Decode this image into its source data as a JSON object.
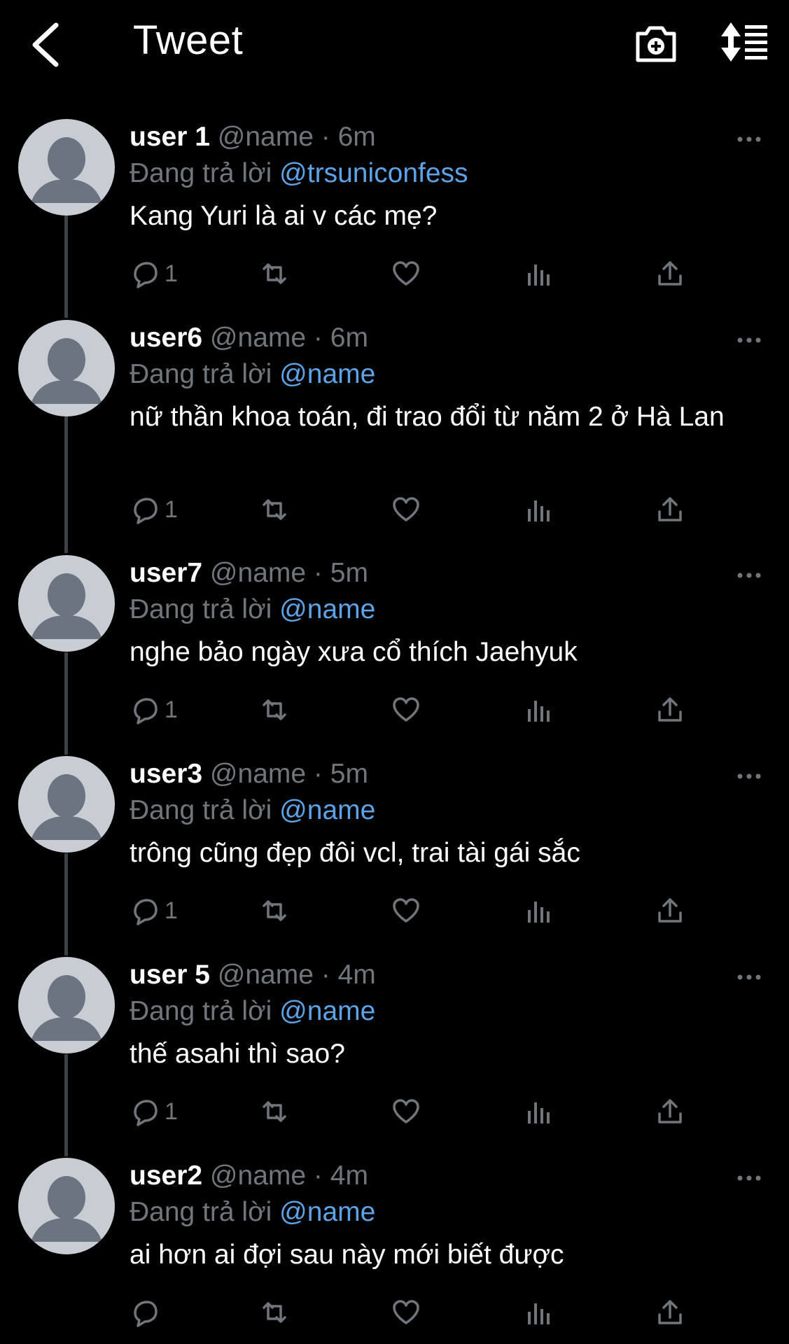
{
  "header": {
    "title": "Tweet"
  },
  "reply_prefix": "Đang trả lời",
  "tweets": [
    {
      "user": "user 1",
      "handle": "@name",
      "time": "6m",
      "mention": "@trsuniconfess",
      "text": "Kang Yuri là ai v các mẹ?",
      "reply_count": "1"
    },
    {
      "user": "user6",
      "handle": "@name",
      "time": "6m",
      "mention": "@name",
      "text": "nữ thần khoa toán, đi trao đổi từ năm 2 ở Hà Lan",
      "reply_count": "1"
    },
    {
      "user": "user7",
      "handle": "@name",
      "time": "5m",
      "mention": "@name",
      "text": "nghe bảo ngày xưa cổ thích Jaehyuk",
      "reply_count": "1"
    },
    {
      "user": "user3",
      "handle": "@name",
      "time": "5m",
      "mention": "@name",
      "text": "trông cũng đẹp đôi vcl, trai tài gái sắc",
      "reply_count": "1"
    },
    {
      "user": "user 5",
      "handle": "@name",
      "time": "4m",
      "mention": "@name",
      "text": "thế asahi thì sao?",
      "reply_count": "1"
    },
    {
      "user": "user2",
      "handle": "@name",
      "time": "4m",
      "mention": "@name",
      "text": "ai hơn ai đợi sau này mới biết được",
      "reply_count": ""
    }
  ],
  "colors": {
    "background": "#000000",
    "mention": "#5ca3e8",
    "muted": "#71767b",
    "avatar": "#c8cdd3",
    "avatar_figure": "#6b7480"
  },
  "icons": [
    "back-arrow-icon",
    "camera-plus-icon",
    "sort-icon",
    "more-icon",
    "reply-icon",
    "retweet-icon",
    "like-icon",
    "views-icon",
    "share-icon"
  ]
}
